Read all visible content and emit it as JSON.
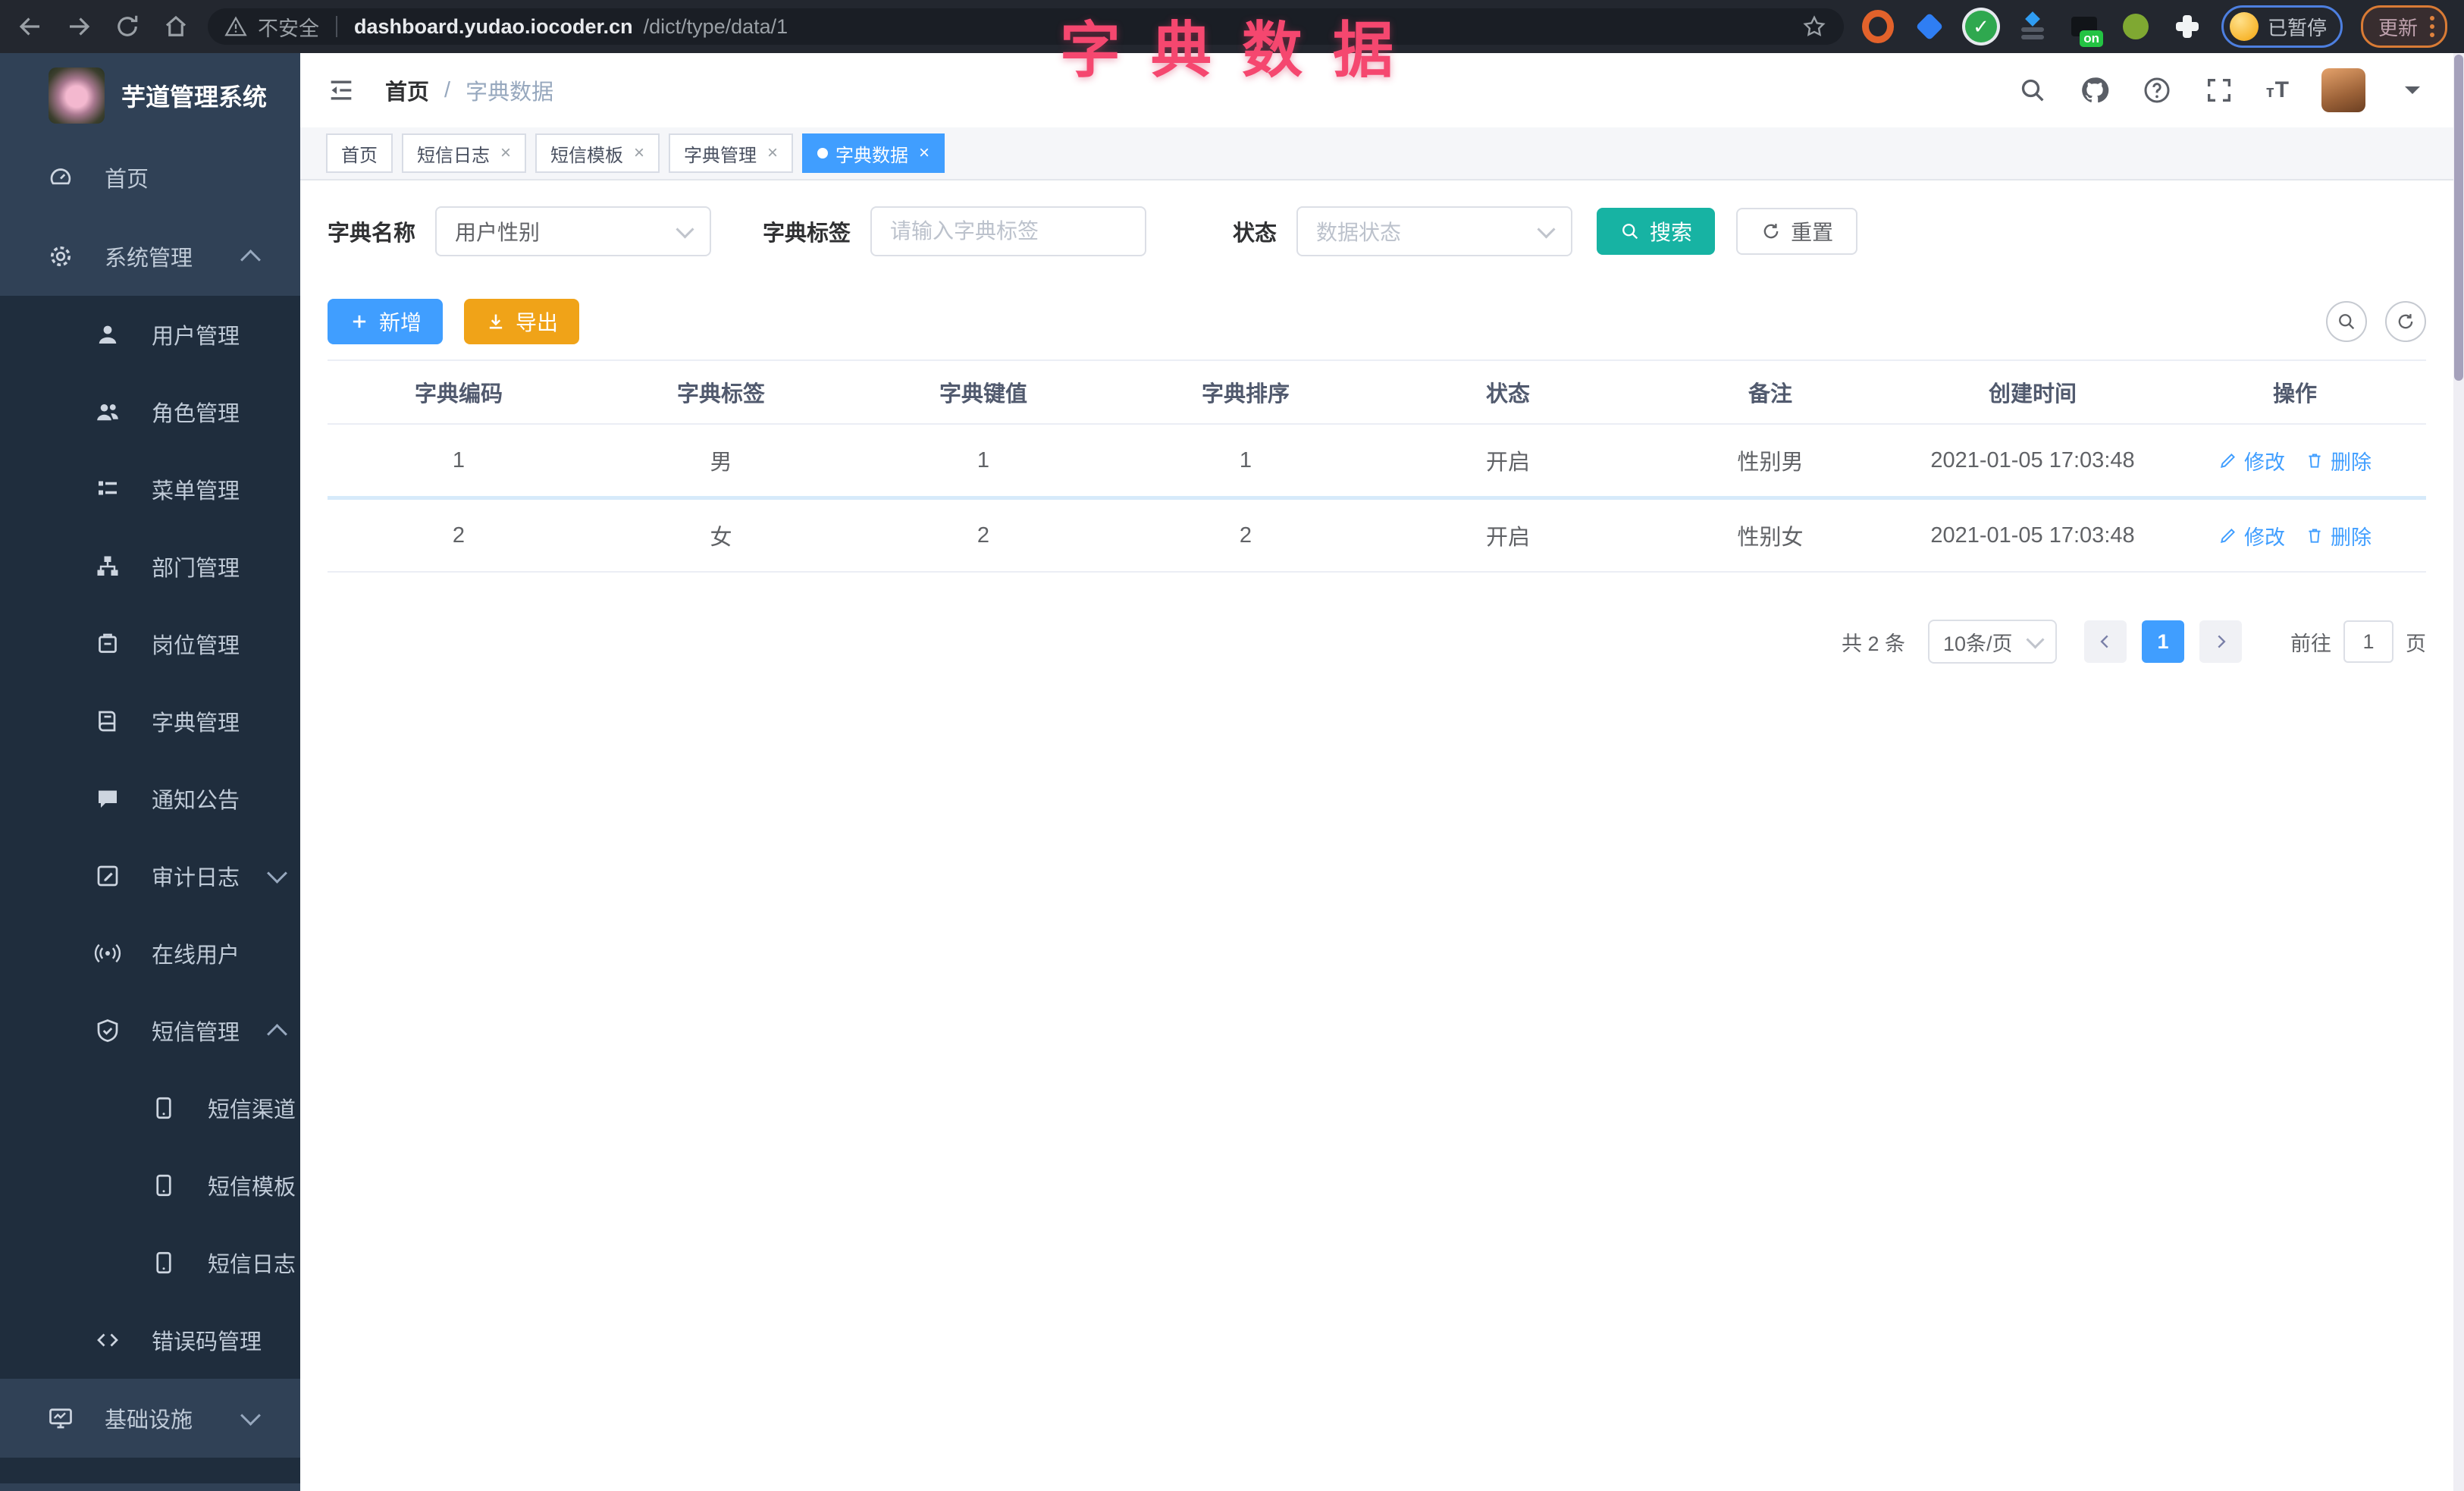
{
  "overlay_title": "字典数据",
  "browser": {
    "security_label": "不安全",
    "url_host": "dashboard.yudao.iocoder.cn",
    "url_path": "/dict/type/data/1",
    "extension_on_badge": "on",
    "paused_label": "已暂停",
    "update_label": "更新"
  },
  "sidebar": {
    "logo_title": "芋道管理系统",
    "items": [
      {
        "label": "首页",
        "icon": "dashboard-icon",
        "level": 0
      },
      {
        "label": "系统管理",
        "icon": "gear-icon",
        "level": 0,
        "state": "expanded"
      },
      {
        "label": "用户管理",
        "icon": "user-icon",
        "level": 1
      },
      {
        "label": "角色管理",
        "icon": "users-icon",
        "level": 1
      },
      {
        "label": "菜单管理",
        "icon": "menu-list-icon",
        "level": 1
      },
      {
        "label": "部门管理",
        "icon": "org-tree-icon",
        "level": 1
      },
      {
        "label": "岗位管理",
        "icon": "badge-icon",
        "level": 1
      },
      {
        "label": "字典管理",
        "icon": "dict-book-icon",
        "level": 1
      },
      {
        "label": "通知公告",
        "icon": "announcement-icon",
        "level": 1
      },
      {
        "label": "审计日志",
        "icon": "audit-log-icon",
        "level": 1,
        "state": "collapsed"
      },
      {
        "label": "在线用户",
        "icon": "online-users-icon",
        "level": 1
      },
      {
        "label": "短信管理",
        "icon": "sms-shield-icon",
        "level": 1,
        "state": "expanded"
      },
      {
        "label": "短信渠道",
        "icon": "phone-icon",
        "level": 2
      },
      {
        "label": "短信模板",
        "icon": "phone-icon",
        "level": 2
      },
      {
        "label": "短信日志",
        "icon": "phone-icon",
        "level": 2
      },
      {
        "label": "错误码管理",
        "icon": "code-icon",
        "level": 1
      },
      {
        "label": "基础设施",
        "icon": "monitor-icon",
        "level": 0,
        "state": "collapsed"
      }
    ]
  },
  "header": {
    "breadcrumb_home": "首页",
    "breadcrumb_separator": "/",
    "breadcrumb_current": "字典数据"
  },
  "tabs": [
    {
      "label": "首页",
      "active": false,
      "closable": false
    },
    {
      "label": "短信日志",
      "active": false,
      "closable": true
    },
    {
      "label": "短信模板",
      "active": false,
      "closable": true
    },
    {
      "label": "字典管理",
      "active": false,
      "closable": true
    },
    {
      "label": "字典数据",
      "active": true,
      "closable": true
    }
  ],
  "filters": {
    "dict_name_label": "字典名称",
    "dict_name_value": "用户性别",
    "dict_label_label": "字典标签",
    "dict_label_placeholder": "请输入字典标签",
    "status_label": "状态",
    "status_placeholder": "数据状态",
    "search_label": "搜索",
    "reset_label": "重置"
  },
  "toolbar": {
    "add_label": "新增",
    "export_label": "导出"
  },
  "table": {
    "headers": [
      "字典编码",
      "字典标签",
      "字典键值",
      "字典排序",
      "状态",
      "备注",
      "创建时间",
      "操作"
    ],
    "rows": [
      {
        "code": "1",
        "label": "男",
        "value": "1",
        "sort": "1",
        "status": "开启",
        "remark": "性别男",
        "created": "2021-01-05 17:03:48"
      },
      {
        "code": "2",
        "label": "女",
        "value": "2",
        "sort": "2",
        "status": "开启",
        "remark": "性别女",
        "created": "2021-01-05 17:03:48"
      }
    ],
    "edit_label": "修改",
    "delete_label": "删除"
  },
  "pagination": {
    "total": "共 2 条",
    "page_size": "10条/页",
    "page": "1",
    "goto_label": "前往",
    "goto_value": "1",
    "page_unit": "页"
  },
  "colors": {
    "accent": "#409eff",
    "search_button": "#17b3a3",
    "export_button": "#f0a318",
    "sidebar_bg": "#304156",
    "submenu_bg": "#1f2d3d",
    "overlay_pink": "#f5476f"
  }
}
